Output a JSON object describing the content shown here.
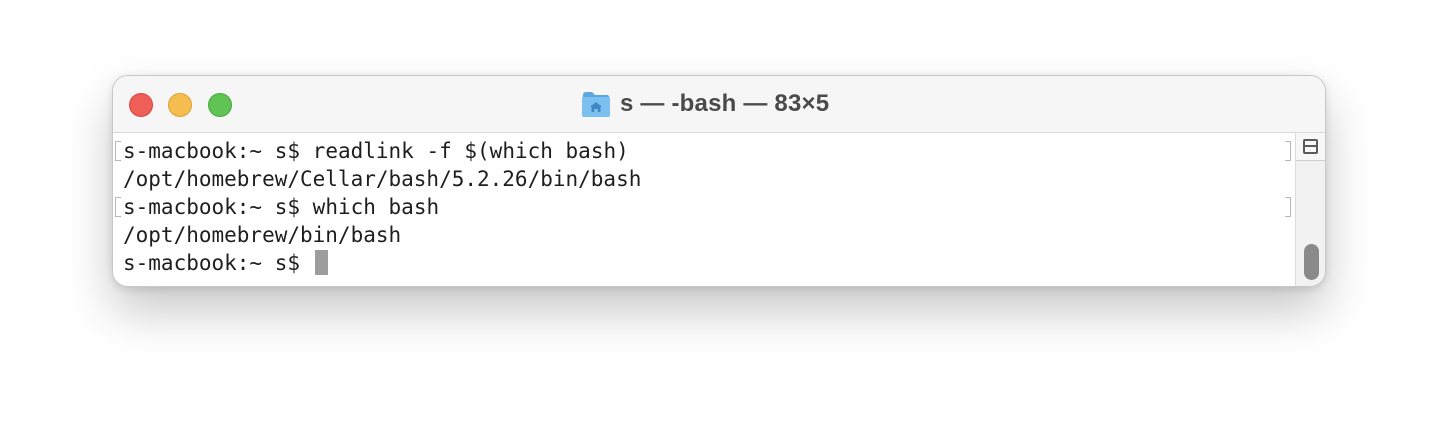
{
  "window": {
    "title": "s — -bash — 83×5",
    "folder_icon": "folder-home-icon"
  },
  "controls": {
    "close_icon": "close-icon",
    "minimize_icon": "minimize-icon",
    "zoom_icon": "zoom-icon",
    "colors": {
      "close": "#ee5f57",
      "minimize": "#f5bd4f",
      "zoom": "#5fc454"
    }
  },
  "terminal": {
    "lines": [
      {
        "prompt": "s-macbook:~ s$",
        "command": "readlink -f $(which bash)"
      },
      {
        "output": "/opt/homebrew/Cellar/bash/5.2.26/bin/bash"
      },
      {
        "prompt": "s-macbook:~ s$",
        "command": "which bash"
      },
      {
        "output": "/opt/homebrew/bin/bash"
      },
      {
        "prompt": "s-macbook:~ s$",
        "command": ""
      }
    ]
  },
  "scrollbar": {
    "split_icon": "split-pane-icon",
    "thumb_color": "#8a8a8a"
  }
}
